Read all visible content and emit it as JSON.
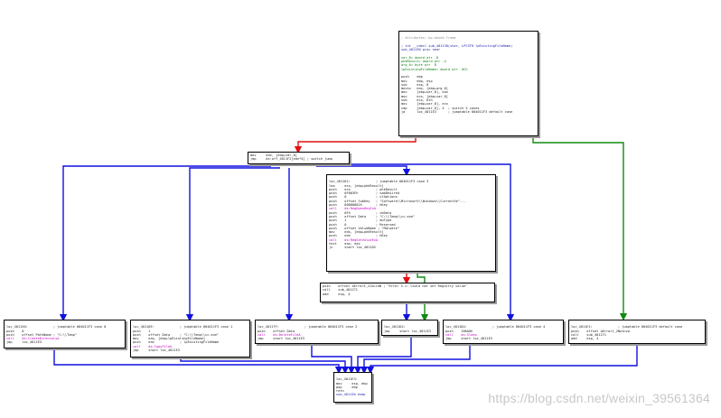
{
  "nodes": [
    {
      "id": "entry",
      "lines": [
        {
          "t": "",
          "c": "blk"
        },
        {
          "t": "; Attributes: bp-based frame",
          "c": "gray"
        },
        {
          "t": "",
          "c": "blk"
        },
        {
          "t": "; int __cdecl sub_401130(char, LPCSTR lpExistingFileName)",
          "c": "blue"
        },
        {
          "t": "sub_401130 proc near",
          "c": "blue"
        },
        {
          "t": "",
          "c": "blk"
        },
        {
          "t": "var_8= dword ptr -8",
          "c": "grn"
        },
        {
          "t": "phkResult= dword ptr -4",
          "c": "grn"
        },
        {
          "t": "arg_0= byte ptr  8",
          "c": "grn"
        },
        {
          "t": "lpExistingFileName= dword ptr  0Ch",
          "c": "grn"
        },
        {
          "t": "",
          "c": "blk"
        },
        {
          "t": "push    ebp",
          "c": "blk"
        },
        {
          "t": "mov     ebp, esp",
          "c": "blk"
        },
        {
          "t": "sub     esp, 8",
          "c": "blk"
        },
        {
          "t": "movsx   eax, [ebp+arg_0]",
          "c": "blk"
        },
        {
          "t": "mov     [ebp+var_8], eax",
          "c": "blk"
        },
        {
          "t": "mov     ecx, [ebp+var_8]",
          "c": "blk"
        },
        {
          "t": "sub     ecx, 61h",
          "c": "blk"
        },
        {
          "t": "mov     [ebp+var_8], ecx",
          "c": "blk"
        },
        {
          "t": "cmp     [ebp+var_8], 4  ; switch 5 cases",
          "c": "blk"
        },
        {
          "t": "ja      loc_4011E3      ; jumptable 004011F3 default case",
          "c": "blk"
        }
      ]
    },
    {
      "id": "switch",
      "lines": [
        {
          "t": "mov     edx, [ebp+var_8]",
          "c": "blk"
        },
        {
          "t": "jmp     ds:off_4011F2[edx*4] ; switch jump",
          "c": "blk"
        }
      ]
    },
    {
      "id": "case3",
      "lines": [
        {
          "t": "",
          "c": "blk"
        },
        {
          "t": "loc_401161:             ; jumptable 004011F3 case 3",
          "c": "blk"
        },
        {
          "t": "lea     ecx, [ebp+phkResult]",
          "c": "blk"
        },
        {
          "t": "push    ecx             ; phkResult",
          "c": "blk"
        },
        {
          "t": "push    0F003Fh         ; samDesired",
          "c": "blk"
        },
        {
          "t": "push    0               ; ulOptions",
          "c": "blk"
        },
        {
          "t": "push    offset SubKey   ; \"Software\\\\Microsoft\\\\Windows\\\\CurrentVe\"...",
          "c": "blk"
        },
        {
          "t": "push    80000002h       ; hKey",
          "c": "blk"
        },
        {
          "t": "call    ds:RegOpenKeyExA",
          "c": "pink"
        },
        {
          "t": "push    0Fh             ; cbData",
          "c": "blk"
        },
        {
          "t": "push    offset Data     ; \"C:\\\\Temp\\\\cc.exe\"",
          "c": "blk"
        },
        {
          "t": "push    1               ; dwType",
          "c": "blk"
        },
        {
          "t": "push    0               ; Reserved",
          "c": "blk"
        },
        {
          "t": "push    offset ValueName ; \"Malware\"",
          "c": "blk"
        },
        {
          "t": "mov     edx, [ebp+phkResult]",
          "c": "blk"
        },
        {
          "t": "push    edx             ; hKey",
          "c": "blk"
        },
        {
          "t": "call    ds:RegSetValueExA",
          "c": "pink"
        },
        {
          "t": "test    eax, eax",
          "c": "blk"
        },
        {
          "t": "jz      short loc_4011D2",
          "c": "blk"
        }
      ]
    },
    {
      "id": "error",
      "lines": [
        {
          "t": "push    offset aError3_1CouldN ; \"Error 3.1: Could not set Registry value\"",
          "c": "blk"
        },
        {
          "t": "call    sub_401271",
          "c": "blk"
        },
        {
          "t": "add     esp, 4",
          "c": "blk"
        }
      ]
    },
    {
      "id": "case0",
      "lines": [
        {
          "t": "",
          "c": "blk"
        },
        {
          "t": "loc_401150:             ; jumptable 004011F3 case 0",
          "c": "blk"
        },
        {
          "t": "push    0",
          "c": "blk"
        },
        {
          "t": "push    offset PathName ; \"C:\\\\Temp\"",
          "c": "blk"
        },
        {
          "t": "call    ds:CreateDirectoryA",
          "c": "pink"
        },
        {
          "t": "jmp     loc_4011E3",
          "c": "blk"
        }
      ]
    },
    {
      "id": "case1",
      "lines": [
        {
          "t": "",
          "c": "blk"
        },
        {
          "t": "loc_40116E:             ; jumptable 004011F3 case 1",
          "c": "blk"
        },
        {
          "t": "push    1",
          "c": "blk"
        },
        {
          "t": "push    offset Data     ; \"C:\\\\Temp\\\\cc.exe\"",
          "c": "blk"
        },
        {
          "t": "mov     eax, [ebp+lpExistingFileName]",
          "c": "blk"
        },
        {
          "t": "push    eax             ; lpExistingFileName",
          "c": "blk"
        },
        {
          "t": "call    ds:CopyFileA",
          "c": "pink"
        },
        {
          "t": "jmp     short loc_4011E3",
          "c": "blk"
        }
      ]
    },
    {
      "id": "case2",
      "lines": [
        {
          "t": "",
          "c": "blk"
        },
        {
          "t": "loc_40117F:             ; jumptable 004011F3 case 2",
          "c": "blk"
        },
        {
          "t": "push    offset Data",
          "c": "blk"
        },
        {
          "t": "call    ds:DeleteFileA",
          "c": "pink"
        },
        {
          "t": "jmp     short loc_4011E3",
          "c": "blk"
        }
      ]
    },
    {
      "id": "loc_4011d2",
      "lines": [
        {
          "t": "",
          "c": "blk"
        },
        {
          "t": "loc_4011D2:",
          "c": "blk"
        },
        {
          "t": "jmp     short loc_4011E3",
          "c": "blk"
        }
      ]
    },
    {
      "id": "case4",
      "lines": [
        {
          "t": "",
          "c": "blk"
        },
        {
          "t": "loc_4011D4:             ; jumptable 004011F3 case 4",
          "c": "blk"
        },
        {
          "t": "push    186A0h",
          "c": "blk"
        },
        {
          "t": "call    ds:Sleep",
          "c": "pink"
        },
        {
          "t": "jmp     short loc_4011E3",
          "c": "blk"
        }
      ]
    },
    {
      "id": "default",
      "lines": [
        {
          "t": "",
          "c": "blk"
        },
        {
          "t": "loc_4011E1:             ; jumptable 004011F3 default case",
          "c": "blk"
        },
        {
          "t": "push    offset aError1_2Notnva",
          "c": "blk"
        },
        {
          "t": "call    sub_401271",
          "c": "blk"
        },
        {
          "t": "add     esp, 4",
          "c": "blk"
        }
      ]
    },
    {
      "id": "exit",
      "lines": [
        {
          "t": "",
          "c": "blk"
        },
        {
          "t": "loc_4011E3:",
          "c": "blk"
        },
        {
          "t": "mov     esp, ebp",
          "c": "blk"
        },
        {
          "t": "pop     ebp",
          "c": "blk"
        },
        {
          "t": "retn",
          "c": "blk"
        },
        {
          "t": "sub_401130 endp",
          "c": "blue"
        }
      ]
    }
  ],
  "colors": {
    "true_edge": "#1010e0",
    "false_edge": "#e01010",
    "cond_edge": "#108a10"
  },
  "watermark": "https://blog.csdn.net/weixin_39561364"
}
